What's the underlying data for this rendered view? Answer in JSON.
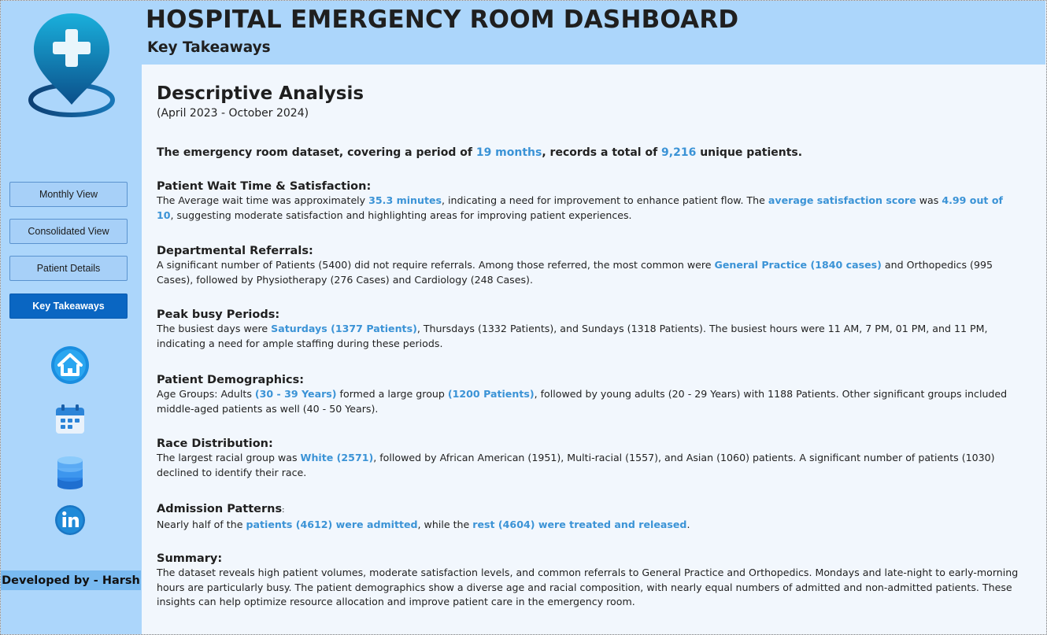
{
  "header": {
    "title": "HOSPITAL EMERGENCY ROOM DASHBOARD",
    "subtitle": "Key Takeaways"
  },
  "sidebar": {
    "logo_icon": "hospital-location-pin-icon",
    "nav": [
      {
        "label": "Monthly View",
        "active": false
      },
      {
        "label": "Consolidated View",
        "active": false
      },
      {
        "label": "Patient Details",
        "active": false
      },
      {
        "label": "Key Takeaways",
        "active": true
      }
    ],
    "icons": [
      "home-icon",
      "calendar-icon",
      "database-icon",
      "linkedin-icon"
    ],
    "developer": "Developed by - Harsh"
  },
  "colors": {
    "header_bg": "#acd6fb",
    "sidebar_bg": "#acd6fb",
    "content_bg": "#f2f7fd",
    "accent": "#0a66c2",
    "highlight_text": "#3b93d6",
    "developer_badge": "#79baf0"
  },
  "content": {
    "heading": "Descriptive Analysis",
    "period": "(April 2023 - October 2024)",
    "intro": [
      {
        "t": "The emergency room dataset, covering a period of "
      },
      {
        "t": "19 months",
        "h": true
      },
      {
        "t": ", records a total of "
      },
      {
        "t": "9,216",
        "h": true
      },
      {
        "t": " unique patients."
      }
    ],
    "sections": [
      {
        "title": "Patient Wait Time & Satisfaction:",
        "body": [
          {
            "t": "The Average wait time was approximately "
          },
          {
            "t": "35.3 minutes",
            "h": true
          },
          {
            "t": ", indicating a need for improvement to enhance patient flow. The "
          },
          {
            "t": "average satisfaction score",
            "h": true
          },
          {
            "t": " was "
          },
          {
            "t": "4.99 out of 10",
            "h": true
          },
          {
            "t": ", suggesting moderate satisfaction and highlighting areas for improving patient experiences."
          }
        ]
      },
      {
        "title": "Departmental Referrals:",
        "body": [
          {
            "t": "A significant number of Patients (5400) did not require referrals. Among those referred, the most common were "
          },
          {
            "t": "General Practice (1840 cases)",
            "h": true
          },
          {
            "t": " and Orthopedics (995 Cases), followed by Physiotherapy (276 Cases) and Cardiology (248 Cases)."
          }
        ]
      },
      {
        "title": "Peak busy Periods:",
        "body": [
          {
            "t": "The busiest days were "
          },
          {
            "t": "Saturdays (1377 Patients)",
            "h": true
          },
          {
            "t": ", Thursdays (1332 Patients), and Sundays (1318 Patients). The busiest hours were 11 AM, 7 PM, 01 PM, and 11 PM, indicating a need for ample staffing during these periods."
          }
        ]
      },
      {
        "title": "Patient Demographics:",
        "body": [
          {
            "t": "Age Groups: Adults "
          },
          {
            "t": "(30 - 39 Years)",
            "h": true
          },
          {
            "t": " formed a large group "
          },
          {
            "t": "(1200 Patients)",
            "h": true
          },
          {
            "t": ", followed by young adults (20 - 29 Years) with 1188 Patients. Other significant groups included middle-aged patients as well (40 - 50 Years)."
          }
        ]
      },
      {
        "title": "Race Distribution:",
        "body": [
          {
            "t": "The largest racial group was "
          },
          {
            "t": "White (2571)",
            "h": true
          },
          {
            "t": ", followed by African American (1951), Multi-racial (1557), and Asian (1060) patients. A significant number of patients (1030) declined to identify their race."
          }
        ]
      },
      {
        "title": "Admission Patterns",
        "title_suffix": ":",
        "body": [
          {
            "t": "Nearly half of the "
          },
          {
            "t": "patients (4612) were admitted",
            "h": true
          },
          {
            "t": ", while the "
          },
          {
            "t": "rest (4604) were treated and released",
            "h": true
          },
          {
            "t": "."
          }
        ]
      },
      {
        "title": "Summary:",
        "body": [
          {
            "t": "The dataset reveals high patient volumes, moderate satisfaction levels, and common referrals to General Practice and Orthopedics. Mondays and late-night to early-morning hours are particularly busy. The patient demographics show a diverse age and racial composition, with nearly equal numbers of admitted and non-admitted patients. These insights can help optimize resource allocation and improve patient care in the emergency room."
          }
        ]
      }
    ]
  }
}
